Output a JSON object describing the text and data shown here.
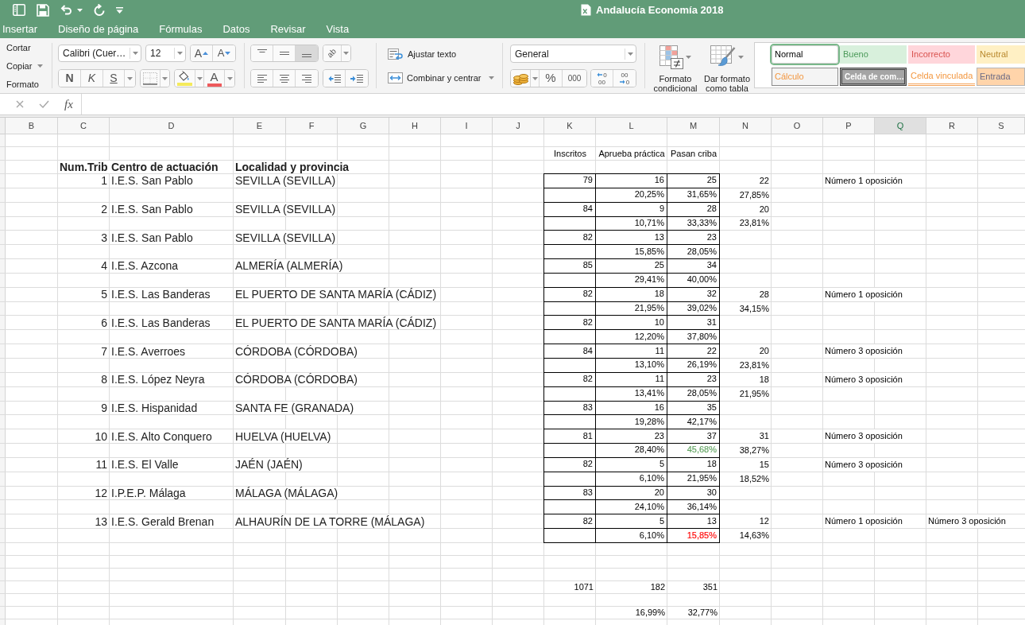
{
  "window": {
    "title": "Andalucía Economía 2018"
  },
  "tabs": [
    "Insertar",
    "Diseño de página",
    "Fórmulas",
    "Datos",
    "Revisar",
    "Vista"
  ],
  "ribbon": {
    "clipboard": [
      {
        "label": "Cortar",
        "menu": false
      },
      {
        "label": "Copiar",
        "menu": true
      },
      {
        "label": "Formato",
        "menu": false
      }
    ],
    "font": {
      "name": "Calibri (Cuer…",
      "size": "12",
      "grow": "A",
      "shrink": "A",
      "bold": "N",
      "italic": "K",
      "underline": "S",
      "font_color_label": "A"
    },
    "alignment": {
      "vertical": [
        {
          "kind": "top",
          "selected": false
        },
        {
          "kind": "middle",
          "selected": false
        },
        {
          "kind": "bottom",
          "selected": true
        }
      ],
      "orientation": "ab",
      "horizontal": [
        {
          "kind": "left",
          "selected": false
        },
        {
          "kind": "center",
          "selected": false
        },
        {
          "kind": "right",
          "selected": false
        }
      ]
    },
    "wrap_text": "Ajustar texto",
    "merge_center": "Combinar y centrar",
    "number": {
      "format": "General",
      "percent": "%",
      "thousands": "000",
      "increase_decimals": [
        "0",
        "00"
      ],
      "decrease_decimals": [
        "00",
        "0"
      ]
    },
    "conditional_format": "Formato condicional",
    "format_as_table": "Dar formato como tabla",
    "cell_styles": [
      {
        "label": "Normal",
        "kind": "normal",
        "selected": true
      },
      {
        "label": "Bueno",
        "kind": "good",
        "selected": false
      },
      {
        "label": "Incorrecto",
        "kind": "bad",
        "selected": false
      },
      {
        "label": "Neutral",
        "kind": "neutral",
        "selected": false
      },
      {
        "label": "Cálculo",
        "kind": "calculation",
        "selected": false
      },
      {
        "label": "Celda de com…",
        "kind": "check",
        "selected": false
      },
      {
        "label": "Celda vinculada",
        "kind": "linked",
        "selected": false
      },
      {
        "label": "Entrada",
        "kind": "input",
        "selected": false
      }
    ]
  },
  "formula_bar": {
    "function_label": "fx"
  },
  "sheet": {
    "columns": [
      {
        "label": "B",
        "selected": false
      },
      {
        "label": "C",
        "selected": false
      },
      {
        "label": "D",
        "selected": false
      },
      {
        "label": "E",
        "selected": false
      },
      {
        "label": "F",
        "selected": false
      },
      {
        "label": "G",
        "selected": false
      },
      {
        "label": "H",
        "selected": false
      },
      {
        "label": "I",
        "selected": false
      },
      {
        "label": "J",
        "selected": false
      },
      {
        "label": "K",
        "selected": false
      },
      {
        "label": "L",
        "selected": false
      },
      {
        "label": "M",
        "selected": false
      },
      {
        "label": "N",
        "selected": false
      },
      {
        "label": "O",
        "selected": false
      },
      {
        "label": "P",
        "selected": false
      },
      {
        "label": "Q",
        "selected": true
      },
      {
        "label": "R",
        "selected": false
      },
      {
        "label": "S",
        "selected": false
      }
    ],
    "labels": {
      "registered": "Inscritos",
      "pass_practical": "Aprueba práctica",
      "pass_screen": "Pasan criba"
    },
    "headers": {
      "number": "Num.Trib",
      "centre": "Centro de actuación",
      "locality": "Localidad y provincia"
    },
    "entries": [
      {
        "number": "1",
        "centre": "I.E.S. San Pablo",
        "locality": "SEVILLA (SEVILLA)",
        "registered": "79",
        "pass_practical": "16",
        "pass_screen": "25",
        "column_n": "22",
        "column_p": "Número 1 oposición",
        "practical_pct": "20,25%",
        "screen_pct": {
          "text": "31,65%"
        },
        "column_n_pct": "27,85%"
      },
      {
        "number": "2",
        "centre": "I.E.S. San Pablo",
        "locality": "SEVILLA (SEVILLA)",
        "registered": "84",
        "pass_practical": "9",
        "pass_screen": "28",
        "column_n": "20",
        "practical_pct": "10,71%",
        "screen_pct": {
          "text": "33,33%"
        },
        "column_n_pct": "23,81%"
      },
      {
        "number": "3",
        "centre": "I.E.S. San Pablo",
        "locality": "SEVILLA (SEVILLA)",
        "registered": "82",
        "pass_practical": "13",
        "pass_screen": "23",
        "practical_pct": "15,85%",
        "screen_pct": {
          "text": "28,05%"
        }
      },
      {
        "number": "4",
        "centre": "I.E.S. Azcona",
        "locality": "ALMERÍA (ALMERÍA)",
        "registered": "85",
        "pass_practical": "25",
        "pass_screen": "34",
        "practical_pct": "29,41%",
        "screen_pct": {
          "text": "40,00%"
        }
      },
      {
        "number": "5",
        "centre": "I.E.S. Las Banderas",
        "locality": "EL PUERTO DE SANTA MARÍA (CÁDIZ)",
        "registered": "82",
        "pass_practical": "18",
        "pass_screen": "32",
        "column_n": "28",
        "column_p": "Número 1 oposición",
        "practical_pct": "21,95%",
        "screen_pct": {
          "text": "39,02%"
        },
        "column_n_pct": "34,15%"
      },
      {
        "number": "6",
        "centre": "I.E.S. Las Banderas",
        "locality": "EL PUERTO DE SANTA MARÍA (CÁDIZ)",
        "registered": "82",
        "pass_practical": "10",
        "pass_screen": "31",
        "practical_pct": "12,20%",
        "screen_pct": {
          "text": "37,80%"
        }
      },
      {
        "number": "7",
        "centre": "I.E.S. Averroes",
        "locality": "CÓRDOBA (CÓRDOBA)",
        "registered": "84",
        "pass_practical": "11",
        "pass_screen": "22",
        "column_n": "20",
        "column_p": "Número 3 oposición",
        "practical_pct": "13,10%",
        "screen_pct": {
          "text": "26,19%"
        },
        "column_n_pct": "23,81%"
      },
      {
        "number": "8",
        "centre": "I.E.S. López Neyra",
        "locality": "CÓRDOBA (CÓRDOBA)",
        "registered": "82",
        "pass_practical": "11",
        "pass_screen": "23",
        "column_n": "18",
        "column_p": "Número 3 oposición",
        "practical_pct": "13,41%",
        "screen_pct": {
          "text": "28,05%"
        },
        "column_n_pct": "21,95%"
      },
      {
        "number": "9",
        "centre": "I.E.S. Hispanidad",
        "locality": "SANTA FE (GRANADA)",
        "registered": "83",
        "pass_practical": "16",
        "pass_screen": "35",
        "practical_pct": "19,28%",
        "screen_pct": {
          "text": "42,17%"
        }
      },
      {
        "number": "10",
        "centre": "I.E.S. Alto Conquero",
        "locality": "HUELVA (HUELVA)",
        "registered": "81",
        "pass_practical": "23",
        "pass_screen": "37",
        "column_n": "31",
        "column_p": "Número 3 oposición",
        "practical_pct": "28,40%",
        "screen_pct": {
          "text": "45,68%",
          "color": "#62a462"
        },
        "column_n_pct": "38,27%"
      },
      {
        "number": "11",
        "centre": "I.E.S. El Valle",
        "locality": "JAÉN (JAÉN)",
        "registered": "82",
        "pass_practical": "5",
        "pass_screen": "18",
        "column_n": "15",
        "column_p": "Número 3 oposición",
        "practical_pct": "6,10%",
        "screen_pct": {
          "text": "21,95%"
        },
        "column_n_pct": "18,52%"
      },
      {
        "number": "12",
        "centre": "I.P.E.P. Málaga",
        "locality": "MÁLAGA (MÁLAGA)",
        "registered": "83",
        "pass_practical": "20",
        "pass_screen": "30",
        "practical_pct": "24,10%",
        "screen_pct": {
          "text": "36,14%"
        }
      },
      {
        "number": "13",
        "centre": "I.E.S. Gerald Brenan",
        "locality": "ALHAURÍN DE LA TORRE (MÁLAGA)",
        "registered": "82",
        "pass_practical": "5",
        "pass_screen": "13",
        "column_n": "12",
        "column_p": "Número 1 oposición",
        "column_r": "Número 3 oposición",
        "practical_pct": "6,10%",
        "screen_pct": {
          "text": "15,85%",
          "color": "#ff0000"
        },
        "column_n_pct": "14,63%"
      }
    ],
    "totals": {
      "registered": "1071",
      "pass_practical": "182",
      "pass_screen": "351",
      "practical_pct": "16,99%",
      "screen_pct": "32,77%"
    }
  }
}
